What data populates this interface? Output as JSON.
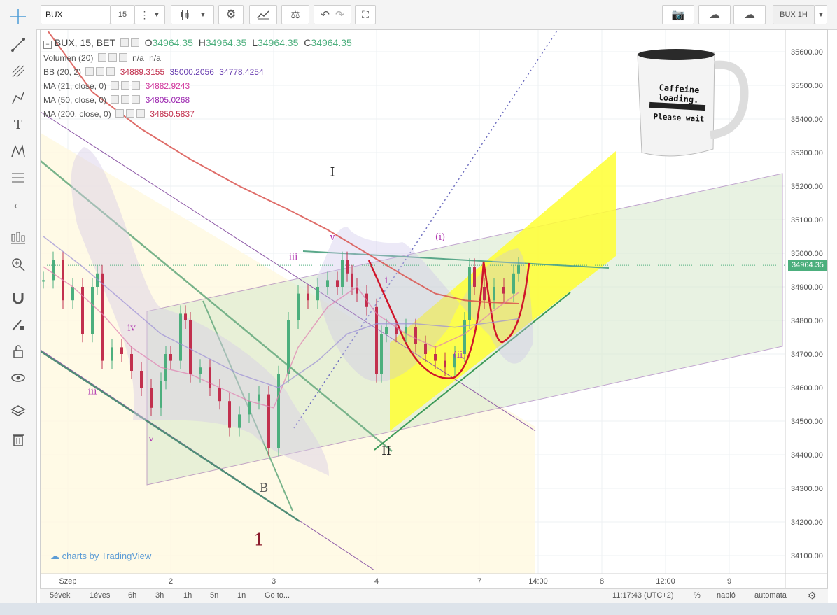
{
  "toolbar": {
    "symbol": "BUX",
    "interval": "15",
    "right_symbol": "BUX 1H"
  },
  "legend": {
    "main": {
      "name": "BUX, 15, BET",
      "o_label": "O",
      "o": "34964.35",
      "h_label": "H",
      "h": "34964.35",
      "l_label": "L",
      "l": "34964.35",
      "c_label": "C",
      "c": "34964.35"
    },
    "volume": {
      "name": "Volumen (20)",
      "v1": "n/a",
      "v2": "n/a"
    },
    "bb": {
      "name": "BB (20, 2)",
      "v1": "34889.3155",
      "v2": "35000.2056",
      "v3": "34778.4254"
    },
    "ma21": {
      "name": "MA (21, close, 0)",
      "v": "34882.9243"
    },
    "ma50": {
      "name": "MA (50, close, 0)",
      "v": "34805.0268"
    },
    "ma200": {
      "name": "MA (200, close, 0)",
      "v": "34850.5837"
    }
  },
  "bottom": {
    "ranges": [
      "5évek",
      "1éves",
      "6h",
      "3h",
      "1h",
      "5n",
      "1n"
    ],
    "goto": "Go to...",
    "clock": "11:17:43 (UTC+2)",
    "percent": "%",
    "log": "napló",
    "auto": "automata"
  },
  "branding": "charts by TradingView",
  "mug": {
    "line1": "Caffeine loading.",
    "line2": "Please wait"
  },
  "colors": {
    "up": "#4caf7d",
    "down": "#c2304e",
    "ma200": "#d9534f",
    "ma21": "#e07fb0",
    "ma50": "#9b8fd6",
    "yellow": "#ffff33",
    "green_fill": "#cfe3c3",
    "channel": "#8e5aa8"
  },
  "chart_data": {
    "type": "candlestick",
    "symbol": "BUX",
    "timeframe": "15",
    "last_price": 34964.35,
    "last_price_label": "34964.35",
    "y_ticks": [
      34100,
      34200,
      34300,
      34400,
      34500,
      34600,
      34700,
      34800,
      34900,
      35000,
      35100,
      35200,
      35300,
      35400,
      35500,
      35600
    ],
    "ylim": [
      34040,
      35660
    ],
    "x_ticks": [
      {
        "label": "Szep",
        "t": 5
      },
      {
        "label": "2",
        "t": 26
      },
      {
        "label": "3",
        "t": 47
      },
      {
        "label": "4",
        "t": 68
      },
      {
        "label": "7",
        "t": 89
      },
      {
        "label": "14:00",
        "t": 101
      },
      {
        "label": "8",
        "t": 114
      },
      {
        "label": "12:00",
        "t": 127
      },
      {
        "label": "9",
        "t": 140
      }
    ],
    "close_path": [
      [
        0,
        34920
      ],
      [
        2,
        34980
      ],
      [
        4,
        34860
      ],
      [
        6,
        34900
      ],
      [
        8,
        34760
      ],
      [
        10,
        34900
      ],
      [
        11,
        34940
      ],
      [
        12,
        34680
      ],
      [
        14,
        34720
      ],
      [
        16,
        34700
      ],
      [
        18,
        34650
      ],
      [
        20,
        34600
      ],
      [
        22,
        34540
      ],
      [
        24,
        34620
      ],
      [
        25,
        34700
      ],
      [
        26,
        34680
      ],
      [
        28,
        34820
      ],
      [
        29,
        34800
      ],
      [
        30,
        34640
      ],
      [
        32,
        34660
      ],
      [
        34,
        34600
      ],
      [
        36,
        34560
      ],
      [
        38,
        34480
      ],
      [
        40,
        34520
      ],
      [
        42,
        34560
      ],
      [
        44,
        34580
      ],
      [
        46,
        34420
      ],
      [
        48,
        34640
      ],
      [
        50,
        34800
      ],
      [
        52,
        34880
      ],
      [
        54,
        34860
      ],
      [
        56,
        34900
      ],
      [
        58,
        34920
      ],
      [
        60,
        34900
      ],
      [
        61,
        34980
      ],
      [
        62,
        34940
      ],
      [
        63,
        34900
      ],
      [
        64,
        34880
      ],
      [
        66,
        34840
      ],
      [
        68,
        34640
      ],
      [
        69,
        34760
      ],
      [
        70,
        34780
      ],
      [
        72,
        34760
      ],
      [
        74,
        34780
      ],
      [
        76,
        34730
      ],
      [
        78,
        34700
      ],
      [
        80,
        34680
      ],
      [
        82,
        34660
      ],
      [
        84,
        34700
      ],
      [
        86,
        34800
      ],
      [
        87,
        34960
      ],
      [
        88,
        34900
      ],
      [
        90,
        34860
      ],
      [
        92,
        34900
      ],
      [
        94,
        34880
      ],
      [
        96,
        34940
      ],
      [
        97,
        34964
      ]
    ],
    "series": [
      {
        "name": "MA (200, close, 0)",
        "points": [
          [
            1,
            35660
          ],
          [
            10,
            35480
          ],
          [
            20,
            35370
          ],
          [
            30,
            35280
          ],
          [
            40,
            35200
          ],
          [
            50,
            35130
          ],
          [
            58,
            35070
          ],
          [
            66,
            35000
          ],
          [
            74,
            34930
          ],
          [
            80,
            34880
          ],
          [
            86,
            34860
          ],
          [
            90,
            34855
          ],
          [
            97,
            34850
          ]
        ]
      },
      {
        "name": "MA (21, close, 0)",
        "points": [
          [
            0,
            34960
          ],
          [
            6,
            34900
          ],
          [
            12,
            34820
          ],
          [
            18,
            34720
          ],
          [
            24,
            34660
          ],
          [
            30,
            34640
          ],
          [
            36,
            34600
          ],
          [
            42,
            34560
          ],
          [
            47,
            34540
          ],
          [
            52,
            34720
          ],
          [
            58,
            34840
          ],
          [
            64,
            34900
          ],
          [
            68,
            34820
          ],
          [
            74,
            34760
          ],
          [
            80,
            34720
          ],
          [
            86,
            34760
          ],
          [
            92,
            34830
          ],
          [
            97,
            34883
          ]
        ]
      },
      {
        "name": "MA (50, close, 0)",
        "points": [
          [
            0,
            35050
          ],
          [
            8,
            34960
          ],
          [
            16,
            34860
          ],
          [
            24,
            34760
          ],
          [
            32,
            34700
          ],
          [
            40,
            34640
          ],
          [
            48,
            34600
          ],
          [
            56,
            34680
          ],
          [
            62,
            34760
          ],
          [
            68,
            34790
          ],
          [
            76,
            34790
          ],
          [
            84,
            34780
          ],
          [
            92,
            34795
          ],
          [
            97,
            34805
          ]
        ]
      }
    ],
    "labels": [
      {
        "text": "I",
        "t": 59,
        "y": 35230,
        "color": "#222"
      },
      {
        "text": "II",
        "t": 70,
        "y": 34400,
        "color": "#222"
      },
      {
        "text": "B",
        "t": 45,
        "y": 34290,
        "color": "#555"
      },
      {
        "text": "1",
        "t": 44,
        "y": 34130,
        "color": "#8b1a2b"
      },
      {
        "text": "v",
        "t": 59,
        "y": 35040,
        "color": "#b037b0"
      },
      {
        "text": "iii",
        "t": 51,
        "y": 34980,
        "color": "#b037b0"
      },
      {
        "text": "(i)",
        "t": 81,
        "y": 35040,
        "color": "#b037b0"
      },
      {
        "text": "(ii)",
        "t": 85,
        "y": 34690,
        "color": "#b037b0"
      },
      {
        "text": "iii",
        "t": 10,
        "y": 34580,
        "color": "#b037b0"
      },
      {
        "text": "v",
        "t": 22,
        "y": 34440,
        "color": "#b037b0"
      },
      {
        "text": "iv",
        "t": 18,
        "y": 34770,
        "color": "#b037b0"
      },
      {
        "text": "i",
        "t": 70,
        "y": 34910,
        "color": "#b037b0"
      }
    ]
  }
}
